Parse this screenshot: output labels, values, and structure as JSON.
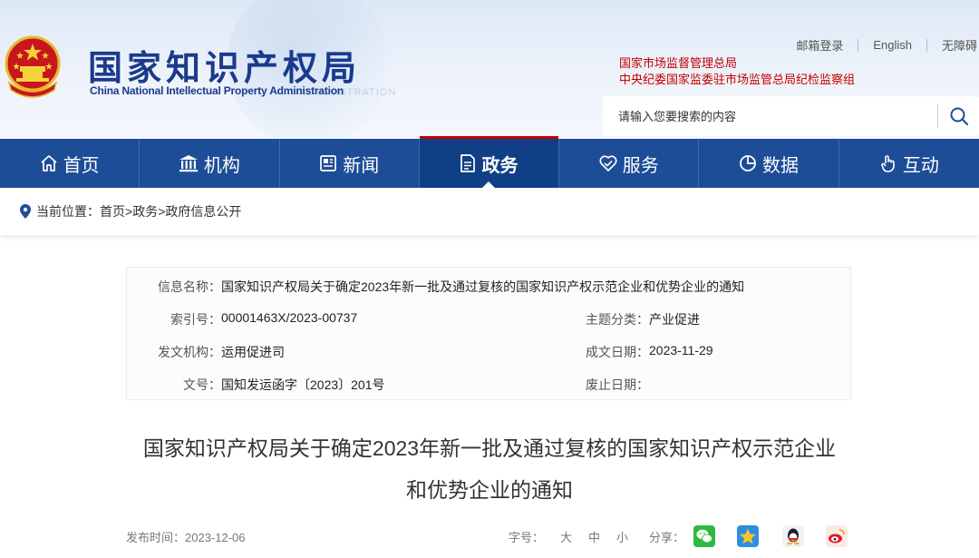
{
  "header": {
    "logo_cn": "国家知识产权局",
    "logo_en": "China National Intellectual Property Administration",
    "bg_text": "ADMINISTRATION",
    "top_links": [
      "邮箱登录",
      "English",
      "无障碍"
    ],
    "supervision": [
      "国家市场监督管理总局",
      "中央纪委国家监委驻市场监管总局纪检监察组"
    ],
    "search_placeholder": "请输入您要搜索的内容"
  },
  "nav": [
    {
      "label": "首页",
      "icon": "home-icon"
    },
    {
      "label": "机构",
      "icon": "institution-icon"
    },
    {
      "label": "新闻",
      "icon": "news-icon"
    },
    {
      "label": "政务",
      "icon": "government-icon",
      "active": true
    },
    {
      "label": "服务",
      "icon": "service-icon"
    },
    {
      "label": "数据",
      "icon": "data-icon"
    },
    {
      "label": "互动",
      "icon": "interaction-icon"
    }
  ],
  "breadcrumb": {
    "prefix": "当前位置：",
    "items": [
      "首页",
      ">",
      "政务",
      ">",
      "政府信息公开"
    ]
  },
  "info": {
    "name_label": "信息名称：",
    "name_value": "国家知识产权局关于确定2023年新一批及通过复核的国家知识产权示范企业和优势企业的通知",
    "index_label": "索引号：",
    "index_value": "00001463X/2023-00737",
    "topic_label": "主题分类：",
    "topic_value": "产业促进",
    "org_label": "发文机构：",
    "org_value": "运用促进司",
    "date_label": "成文日期：",
    "date_value": "2023-11-29",
    "doc_label": "文号：",
    "doc_value": "国知发运函字〔2023〕201号",
    "abolish_label": "废止日期：",
    "abolish_value": ""
  },
  "article": {
    "title_line1": "国家知识产权局关于确定2023年新一批及通过复核的国家知识产权示范企业",
    "title_line2": "和优势企业的通知",
    "publish": "发布时间：2023-12-06",
    "font_label": "字号：",
    "font_sizes": [
      "大",
      "中",
      "小"
    ],
    "share_label": "分享："
  },
  "colors": {
    "nav_bg": "#1d4d97",
    "logo_blue": "#1a3a8c",
    "accent_red": "#c40000"
  }
}
